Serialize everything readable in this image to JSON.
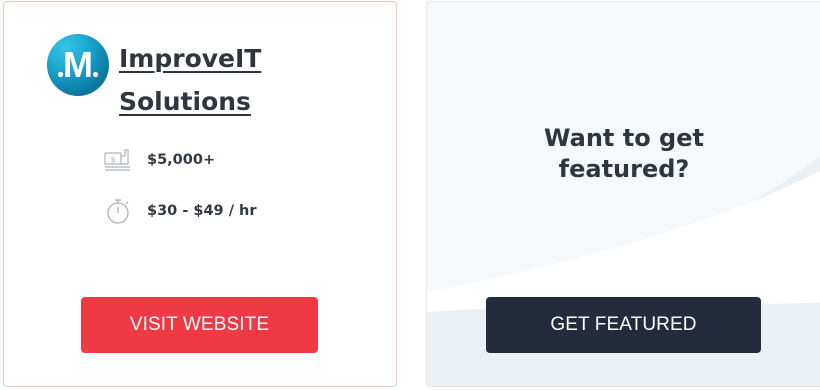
{
  "company_card": {
    "logo_icon": "improveit-logo-icon",
    "logo_letter": "M",
    "name_line1": "ImproveIT",
    "name_line2": "Solutions",
    "budget": {
      "icon": "money-icon",
      "value": "$5,000+"
    },
    "rate": {
      "icon": "stopwatch-icon",
      "value": "$30 - $49 / hr"
    },
    "visit_button": "VISIT WEBSITE"
  },
  "featured_card": {
    "title_line1": "Want to get",
    "title_line2": "featured?",
    "button": "GET FEATURED"
  },
  "colors": {
    "visit_button": "#ef3a44",
    "featured_button": "#232b3c",
    "company_card_border": "#f1c3bd",
    "text_dark": "#2f3640"
  }
}
